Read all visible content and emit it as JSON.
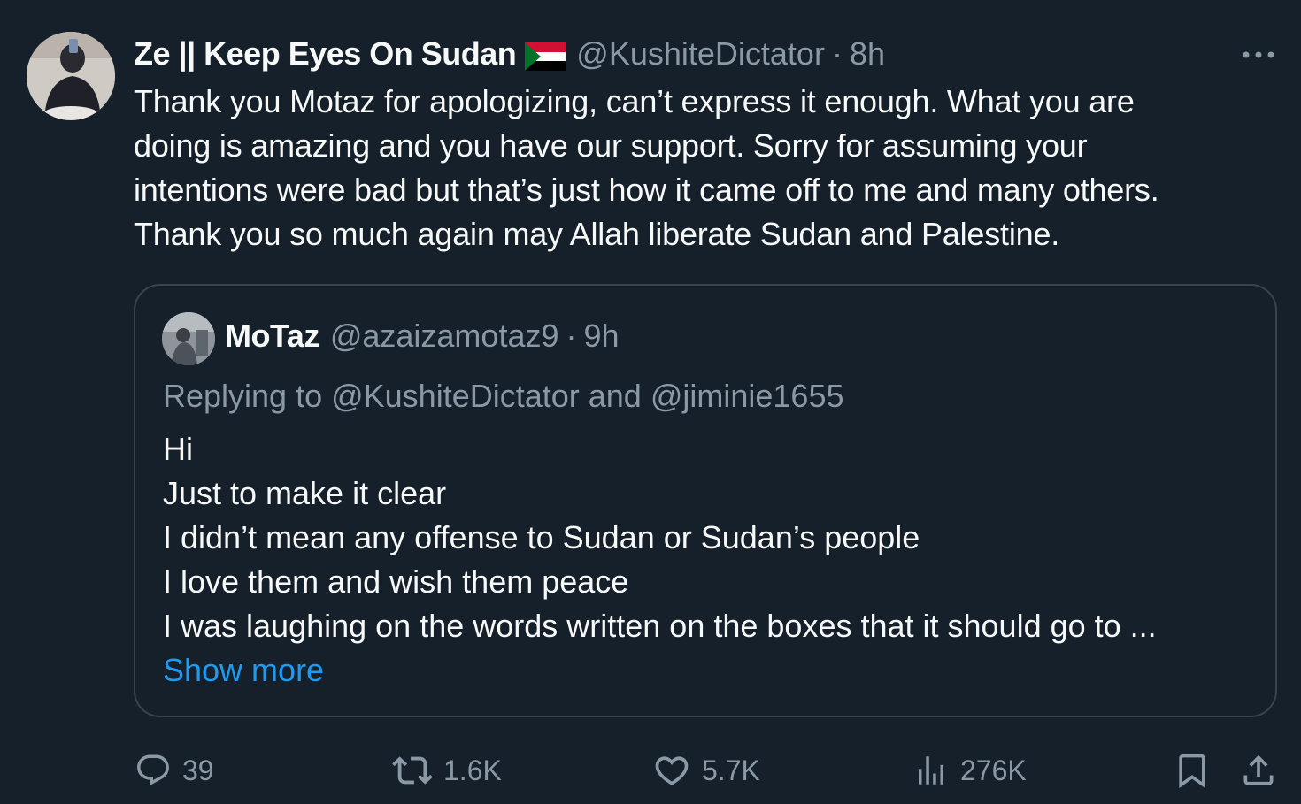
{
  "tweet": {
    "author_name": "Ze || Keep Eyes On Sudan",
    "handle": "@KushiteDictator",
    "separator": "·",
    "time": "8h",
    "text_lines": [
      "Thank you Motaz for apologizing, can’t express it enough. What you are",
      "doing is amazing and you have our support. Sorry for assuming your",
      "intentions were bad but that’s just how it came off to me and many others.",
      "Thank you so much again may Allah liberate Sudan and Palestine."
    ]
  },
  "quote": {
    "author_name": "MoTaz",
    "handle": "@azaizamotaz9",
    "separator": "·",
    "time": "9h",
    "replying_to": "Replying to @KushiteDictator and @jiminie1655",
    "text_lines": [
      "Hi",
      "Just to make it clear",
      "I didn’t mean any offense to Sudan or Sudan’s people",
      "I love them and wish them peace",
      "I was laughing on the words written on the boxes that it should go to ..."
    ],
    "show_more": "Show more"
  },
  "actions": {
    "replies": "39",
    "reposts": "1.6K",
    "likes": "5.7K",
    "views": "276K"
  },
  "colors": {
    "background": "#15202b",
    "text": "#f7f9f9",
    "muted": "#8b98a5",
    "accent": "#1d9bf0",
    "border": "#38444d"
  },
  "icons": [
    "more-icon",
    "sudan-flag-icon",
    "reply-icon",
    "repost-icon",
    "like-icon",
    "views-icon",
    "bookmark-icon",
    "share-icon"
  ]
}
